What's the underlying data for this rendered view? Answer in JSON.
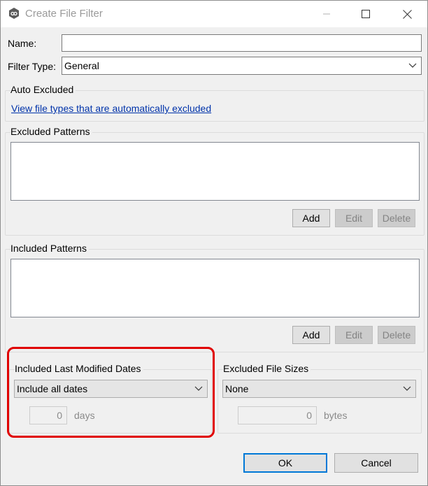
{
  "window": {
    "title": "Create File Filter"
  },
  "form": {
    "name_label": "Name:",
    "name_value": "",
    "filter_type_label": "Filter Type:",
    "filter_type_value": "General"
  },
  "auto_excluded": {
    "title": "Auto Excluded",
    "link": "View file types that are automatically excluded"
  },
  "excluded_patterns": {
    "title": "Excluded Patterns",
    "add": "Add",
    "edit": "Edit",
    "delete": "Delete"
  },
  "included_patterns": {
    "title": "Included Patterns",
    "add": "Add",
    "edit": "Edit",
    "delete": "Delete"
  },
  "modified_dates": {
    "title": "Included Last Modified Dates",
    "selected": "Include all dates",
    "count": "0",
    "unit": "days"
  },
  "file_sizes": {
    "title": "Excluded File Sizes",
    "selected": "None",
    "count": "0",
    "unit": "bytes"
  },
  "footer": {
    "ok": "OK",
    "cancel": "Cancel"
  },
  "colors": {
    "highlight": "#e00000",
    "link": "#0033aa",
    "focus": "#0078d7"
  }
}
